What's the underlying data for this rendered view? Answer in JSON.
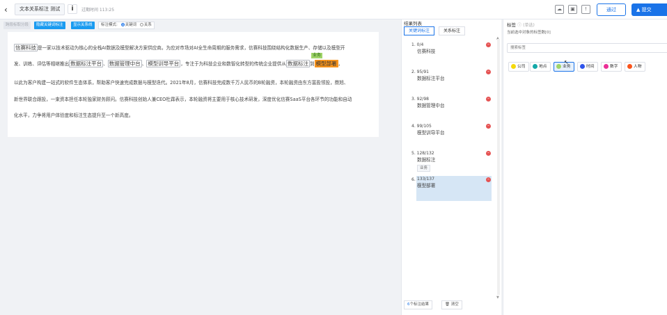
{
  "header": {
    "task_title": "文本关系标注 测试",
    "expire_text": "过期时间 113:25",
    "info_label": "i",
    "pass_label": "通过",
    "submit_label": "提交",
    "icons": [
      "cloud-icon",
      "save-icon",
      "message-icon"
    ]
  },
  "toolbar": {
    "btn_draw": "跨段标取分段",
    "btn_hide_kw": "隐藏关键词标注",
    "btn_show_rel": "显示关系线",
    "mode_label": "标注模式:",
    "mode_kw": "关键词",
    "mode_rel": "关系"
  },
  "document": {
    "line1_pre": "",
    "ent1": "信赛科技",
    "line1_post": "是一家以技术驱动为核心的全栈AI数据及模型解决方案供应商。为应对市场对AI全生命周期的服务需求，信赛科技围绕结构化数据生产、存储以及模型开",
    "line2_pre": "发、训练、评估等相继推出",
    "ent2": "数据标注平台",
    "sep1": "、",
    "ent3": "数据管理中台",
    "sep2": "、",
    "ent4": "模型训导平台",
    "line2_mid": "，专注于为科技企业和数智化转型的传统企业提供从",
    "ent5": "数据标注",
    "line2_to": "到",
    "ent6": "模型部署",
    "line2_end": "，",
    "relation_tag": "业务",
    "line3": "以此为客户构建一站式的软件生态体系，帮助客户快速完成数据与模型迭代。2021年8月，信赛科技完成数千万人民币的B轮融资，本轮融资由东方富盈领投，鼎旭、",
    "line4": "新世界联合跟投，一束资本担任本轮独家财务顾问。信赛科技创始人兼CEO杜霖表示，本轮融资将主要用于核心技术研发，深度优化信赛SaaS平台各环节的功能和自动",
    "line5": "化水平，力争将用户体验度和标注生态提升至一个新高度。"
  },
  "results": {
    "title": "结果列表",
    "tab_kw": "关键词标注",
    "tab_rel": "关系标注",
    "items": [
      {
        "num": "1.",
        "pos": "0/4",
        "name": "信赛科技",
        "tag": ""
      },
      {
        "num": "2.",
        "pos": "95/91",
        "name": "数据标注平台",
        "tag": ""
      },
      {
        "num": "3.",
        "pos": "92/98",
        "name": "数据管理中台",
        "tag": ""
      },
      {
        "num": "4.",
        "pos": "99/105",
        "name": "模型训导平台",
        "tag": ""
      },
      {
        "num": "5.",
        "pos": "128/132",
        "name": "数据标注",
        "tag": "业务"
      },
      {
        "num": "6.",
        "pos": "133/137",
        "name": "模型部署",
        "tag": ""
      }
    ],
    "count_num": "6",
    "count_label": "个标注结果",
    "clear_label": "清空"
  },
  "panel": {
    "title": "标签",
    "title_sub": "(单选)",
    "hint": "当前选中对象的标签数[0]",
    "search_placeholder": "搜索标签",
    "labels": [
      {
        "name": "公司",
        "color": "#f5d90a"
      },
      {
        "name": "地点",
        "color": "#13a8a8"
      },
      {
        "name": "业务",
        "color": "#a0d468"
      },
      {
        "name": "时间",
        "color": "#2f54eb"
      },
      {
        "name": "数字",
        "color": "#eb2f96"
      },
      {
        "name": "人物",
        "color": "#fa541c"
      }
    ]
  }
}
